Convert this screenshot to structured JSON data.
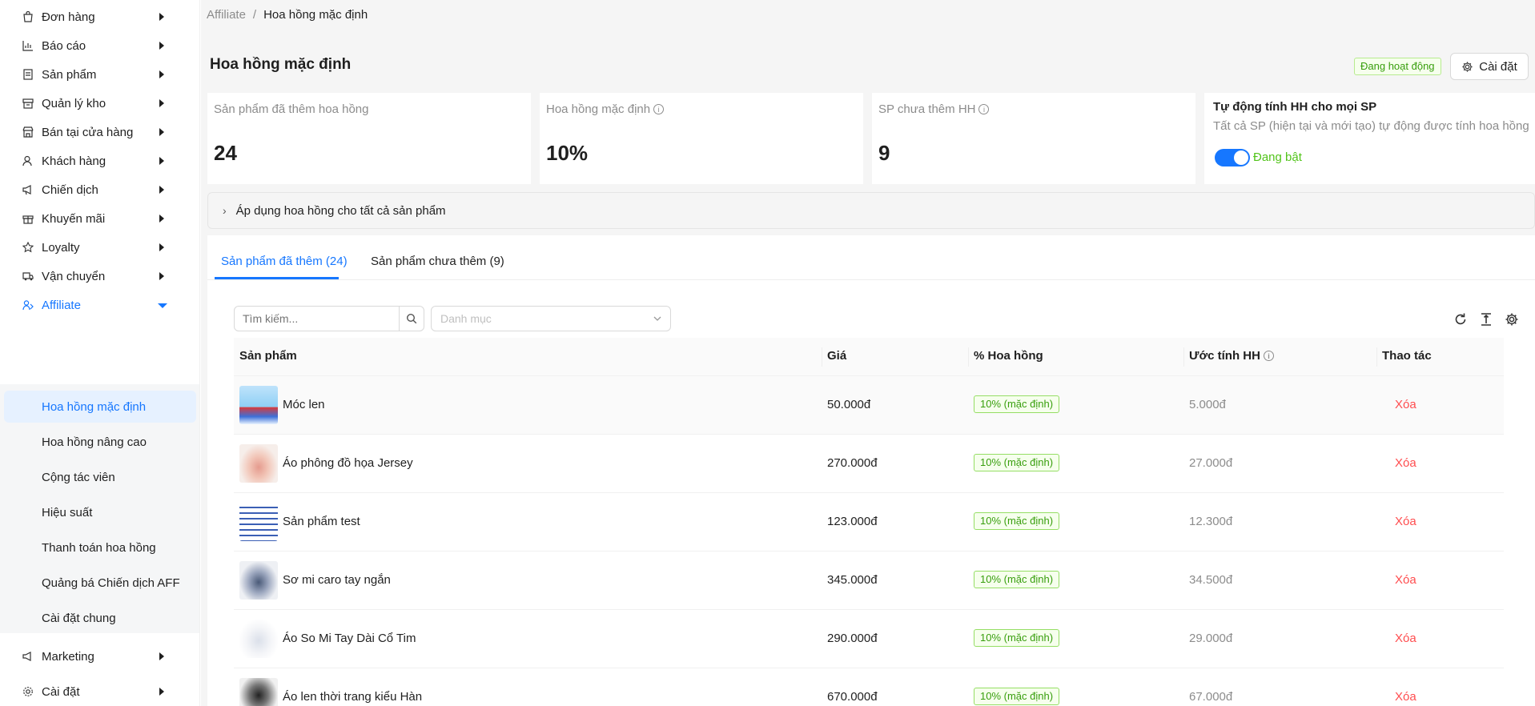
{
  "sidebar": {
    "items": [
      {
        "label": "Đơn hàng",
        "icon": "bag-icon"
      },
      {
        "label": "Báo cáo",
        "icon": "chart-icon"
      },
      {
        "label": "Sản phẩm",
        "icon": "product-icon"
      },
      {
        "label": "Quản lý kho",
        "icon": "warehouse-icon"
      },
      {
        "label": "Bán tại cửa hàng",
        "icon": "store-icon"
      },
      {
        "label": "Khách hàng",
        "icon": "customer-icon"
      },
      {
        "label": "Chiến dịch",
        "icon": "megaphone-icon"
      },
      {
        "label": "Khuyến mãi",
        "icon": "gift-icon"
      },
      {
        "label": "Loyalty",
        "icon": "star-icon"
      },
      {
        "label": "Vận chuyển",
        "icon": "truck-icon"
      },
      {
        "label": "Affiliate",
        "icon": "affiliate-icon"
      },
      {
        "label": "Marketing",
        "icon": "marketing-icon"
      },
      {
        "label": "Cài đặt",
        "icon": "gear-icon"
      }
    ],
    "submenu": [
      "Hoa hồng mặc định",
      "Hoa hồng nâng cao",
      "Cộng tác viên",
      "Hiệu suất",
      "Thanh toán hoa hồng",
      "Quảng bá Chiến dịch AFF",
      "Cài đặt chung"
    ]
  },
  "breadcrumb": {
    "parent": "Affiliate",
    "separator": "/",
    "current": "Hoa hồng mặc định"
  },
  "header": {
    "title": "Hoa hồng mặc định",
    "status": "Đang hoạt động",
    "settings_label": "Cài đặt"
  },
  "cards": {
    "added": {
      "label": "Sản phẩm đã thêm hoa hồng",
      "value": "24"
    },
    "default_rate": {
      "label": "Hoa hồng mặc định",
      "value": "10%"
    },
    "not_added": {
      "label": "SP chưa thêm HH",
      "value": "9"
    },
    "auto": {
      "title": "Tự động tính HH cho mọi SP",
      "desc": "Tất cả SP (hiện tại và mới tạo) tự động được tính hoa hồng",
      "toggle_label": "Đang bật",
      "enabled": true
    }
  },
  "apply_all": {
    "label": "Áp dụng hoa hồng cho tất cả sản phẩm"
  },
  "tabs": [
    {
      "label": "Sản phẩm đã thêm (24)",
      "active": true
    },
    {
      "label": "Sản phẩm chưa thêm (9)",
      "active": false
    }
  ],
  "search": {
    "placeholder": "Tìm kiếm..."
  },
  "category": {
    "placeholder": "Danh mục"
  },
  "table": {
    "columns": [
      "Sản phẩm",
      "Giá",
      "% Hoa hồng",
      "Ước tính HH",
      "Thao tác"
    ],
    "rows": [
      {
        "name": "Móc len",
        "price": "50.000đ",
        "rate": "10% (mặc định)",
        "estimate": "5.000đ",
        "action": "Xóa"
      },
      {
        "name": "Áo phông đồ họa Jersey",
        "price": "270.000đ",
        "rate": "10% (mặc định)",
        "estimate": "27.000đ",
        "action": "Xóa"
      },
      {
        "name": "Sản phẩm test",
        "price": "123.000đ",
        "rate": "10% (mặc định)",
        "estimate": "12.300đ",
        "action": "Xóa"
      },
      {
        "name": "Sơ mi caro tay ngắn",
        "price": "345.000đ",
        "rate": "10% (mặc định)",
        "estimate": "34.500đ",
        "action": "Xóa"
      },
      {
        "name": "Áo So Mi Tay Dài Cổ Tim",
        "price": "290.000đ",
        "rate": "10% (mặc định)",
        "estimate": "29.000đ",
        "action": "Xóa"
      },
      {
        "name": "Áo len thời trang kiểu Hàn",
        "price": "670.000đ",
        "rate": "10% (mặc định)",
        "estimate": "67.000đ",
        "action": "Xóa"
      }
    ]
  },
  "colors": {
    "accent": "#1677ff",
    "danger": "#ff4d4f",
    "success": "#389e0d",
    "highlight": "#e51b1b"
  }
}
